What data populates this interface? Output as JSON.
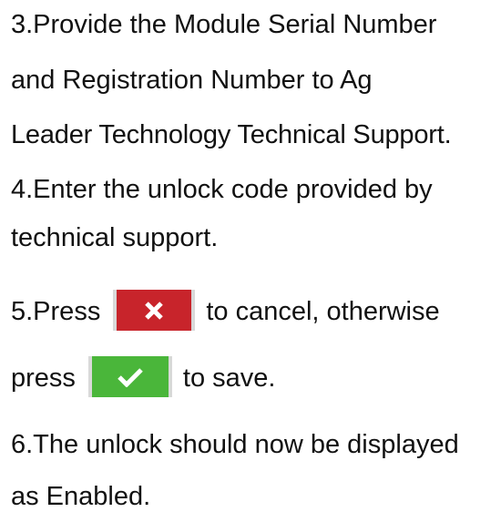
{
  "steps": {
    "step3_line1": "3.Provide the Module Serial Number",
    "step3_line2": "and Registration Number to Ag",
    "step3_line3": "Leader Technology Technical Support.",
    "step4_line1": "4.Enter the unlock code provided by",
    "step4_line2": "technical support.",
    "step5_prefix": "5.Press",
    "step5_suffix": "to cancel, otherwise",
    "step5_line2_prefix": "press",
    "step5_line2_suffix": "to save.",
    "step6_line1": "6.The unlock should now be displayed",
    "step6_line2": "as Enabled."
  },
  "icons": {
    "cancel": "close-icon",
    "save": "checkmark-icon"
  },
  "colors": {
    "cancel_button": "#c8242b",
    "save_button": "#4ab63a",
    "button_edge": "#d9d9d9",
    "text": "#111111"
  }
}
